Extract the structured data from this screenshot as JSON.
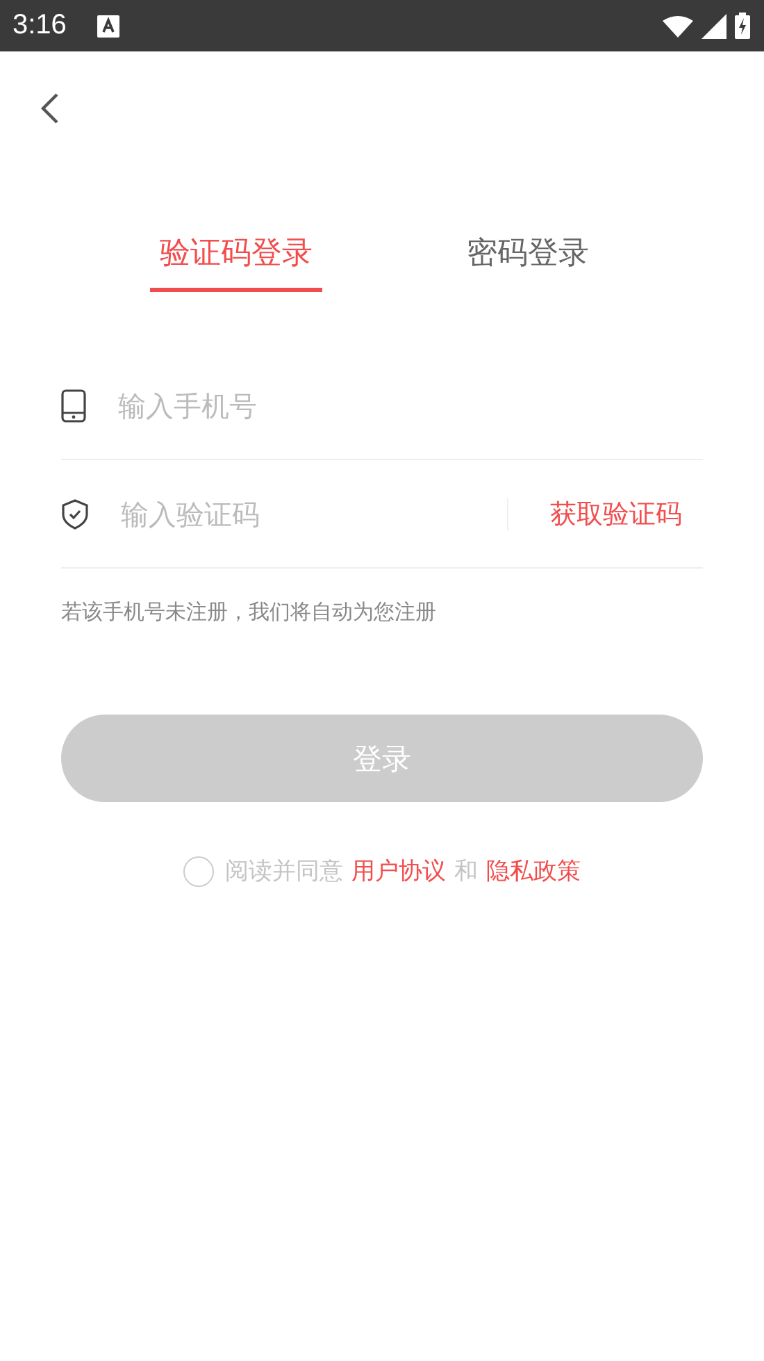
{
  "status_bar": {
    "time": "3:16"
  },
  "tabs": [
    {
      "label": "验证码登录",
      "selected": true
    },
    {
      "label": "密码登录",
      "selected": false
    }
  ],
  "fields": [
    {
      "kind": "phone",
      "placeholder": "输入手机号"
    },
    {
      "kind": "code",
      "placeholder": "输入验证码",
      "action": "获取验证码"
    }
  ],
  "note": "若该手机号未注册，我们将自动为您注册",
  "login_button": {
    "label": "登录",
    "disabled": true
  },
  "agreement": {
    "checked": false,
    "parts": [
      {
        "kind": "text",
        "text": "阅读并同意"
      },
      {
        "kind": "link",
        "text": "用户协议"
      },
      {
        "kind": "text",
        "text": "和"
      },
      {
        "kind": "link",
        "text": "隐私政策"
      }
    ]
  }
}
